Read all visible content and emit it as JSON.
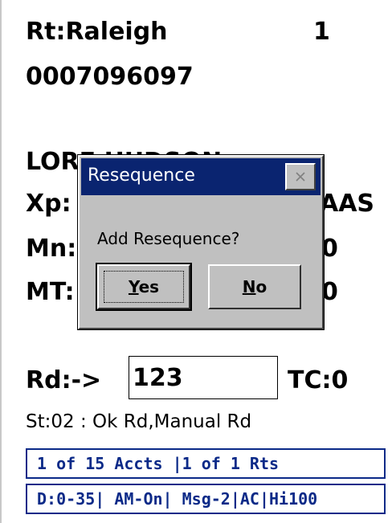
{
  "header": {
    "route": "Rt:Raleigh",
    "route_number": "1",
    "account_number": "0007096097"
  },
  "details": {
    "customer_name": "LORE HUDSON",
    "xp_label": "Xp:",
    "xp_tail": "AAS",
    "mn_label": "Mn:",
    "mn_tail": "0",
    "mt_label": "MT:",
    "mt_tail": "0"
  },
  "reading": {
    "rd_label": "Rd:->",
    "rd_value": "123",
    "tc": "TC:0"
  },
  "status_line": "St:02 : Ok Rd,Manual Rd",
  "accounts_info": "1 of 15 Accts |1 of 1 Rts",
  "flags_info": "D:0-35| AM-On| Msg-2|AC|Hi100",
  "dialog": {
    "title": "Resequence",
    "message": "Add Resequence?",
    "yes_mnemonic": "Y",
    "yes_rest": "es",
    "no_mnemonic": "N",
    "no_rest": "o",
    "close_icon": "close-icon"
  },
  "colors": {
    "title_bar": "#0a2470",
    "info_box": "#0b2a88",
    "dialog_face": "#c0c0c0"
  }
}
